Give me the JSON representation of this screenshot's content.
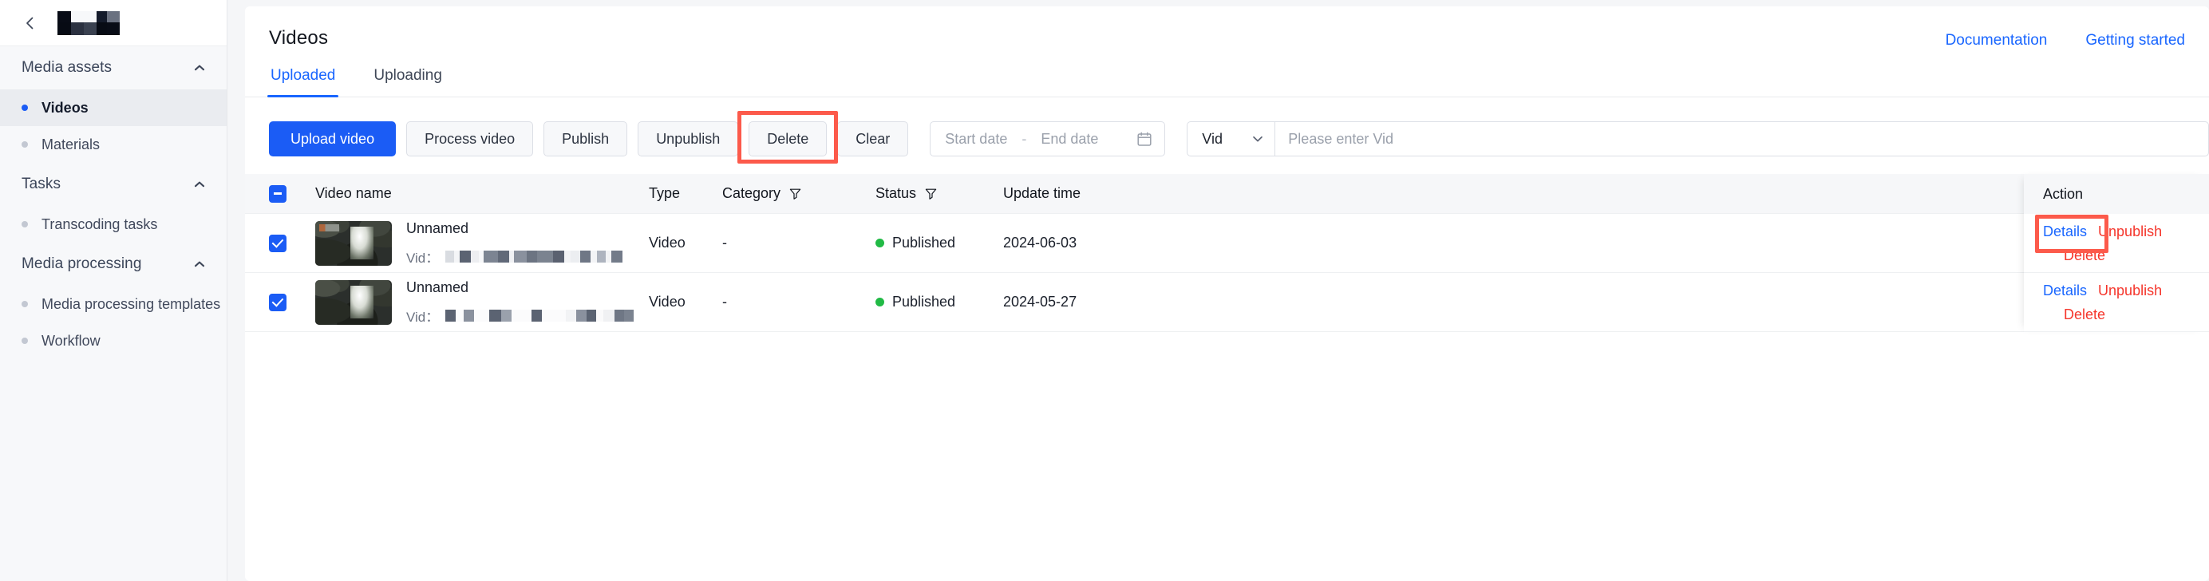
{
  "sidebar": {
    "back_icon": "chevron-left-icon",
    "logo": "redacted-logo",
    "groups": [
      {
        "title": "Media assets",
        "collapse_icon": "chevron-up-icon",
        "items": [
          {
            "label": "Videos",
            "active": true
          },
          {
            "label": "Materials",
            "active": false
          }
        ]
      },
      {
        "title": "Tasks",
        "collapse_icon": "chevron-up-icon",
        "items": [
          {
            "label": "Transcoding tasks",
            "active": false
          }
        ]
      },
      {
        "title": "Media processing",
        "collapse_icon": "chevron-up-icon",
        "items": [
          {
            "label": "Media processing templates",
            "active": false
          },
          {
            "label": "Workflow",
            "active": false
          }
        ]
      }
    ]
  },
  "header": {
    "title": "Videos",
    "links": [
      {
        "label": "Documentation"
      },
      {
        "label": "Getting started"
      }
    ]
  },
  "tabs": [
    {
      "label": "Uploaded",
      "active": true
    },
    {
      "label": "Uploading",
      "active": false
    }
  ],
  "toolbar": {
    "upload_video": "Upload video",
    "process_video": "Process video",
    "publish": "Publish",
    "unpublish": "Unpublish",
    "delete": "Delete",
    "clear": "Clear",
    "date_start_placeholder": "Start date",
    "date_separator": "-",
    "date_end_placeholder": "End date",
    "calendar_icon": "calendar-icon",
    "search_field_select": "Vid",
    "search_select_icon": "chevron-down-icon",
    "search_placeholder": "Please enter Vid"
  },
  "table": {
    "headers": {
      "video_name": "Video name",
      "type": "Type",
      "category": "Category",
      "status": "Status",
      "update_time": "Update time",
      "action": "Action"
    },
    "category_filter_icon": "filter-icon",
    "status_filter_icon": "filter-icon",
    "header_checkbox_state": "indeterminate",
    "rows": [
      {
        "checked": true,
        "name": "Unnamed",
        "vid_label": "Vid：",
        "vid_value": "[redacted]",
        "type": "Video",
        "category": "-",
        "status": "Published",
        "status_color": "#21ba45",
        "update_time": "2024-06-03",
        "actions": {
          "details": "Details",
          "unpublish": "Unpublish",
          "delete": "Delete"
        }
      },
      {
        "checked": true,
        "name": "Unnamed",
        "vid_label": "Vid：",
        "vid_value": "[redacted]",
        "type": "Video",
        "category": "-",
        "status": "Published",
        "status_color": "#21ba45",
        "update_time": "2024-05-27",
        "actions": {
          "details": "Details",
          "unpublish": "Unpublish",
          "delete": "Delete"
        }
      }
    ]
  },
  "annotations": {
    "highlight_color": "#fc5a4b",
    "boxes": [
      {
        "target": "delete-button"
      },
      {
        "target": "details-link-row-1"
      }
    ]
  },
  "colors": {
    "accent": "#1b5cf5",
    "link": "#1966ff",
    "danger": "#f5352b",
    "success": "#21ba45"
  }
}
